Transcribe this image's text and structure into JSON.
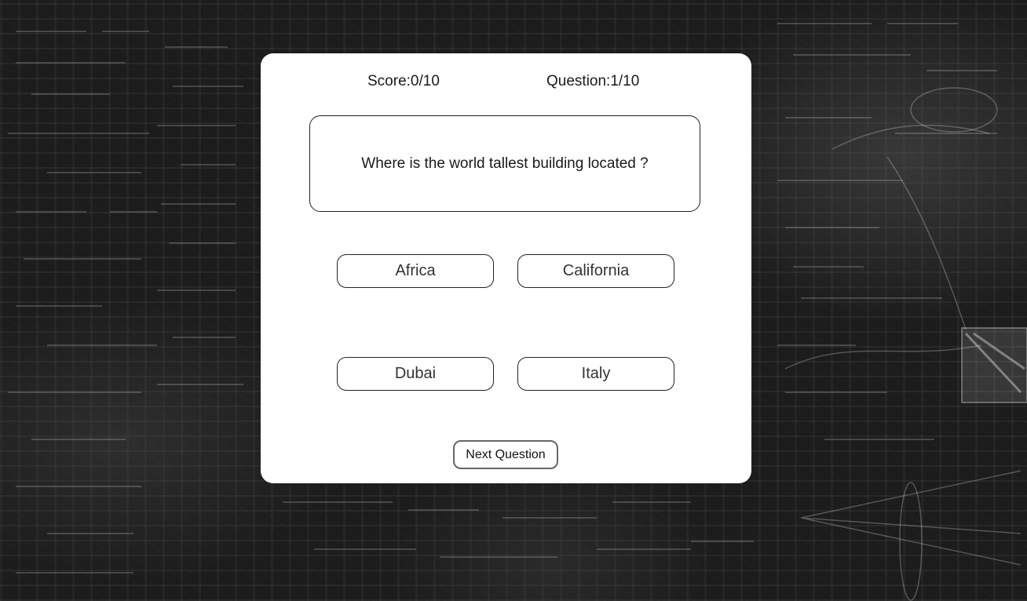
{
  "status": {
    "score": "Score:0/10",
    "question_counter": "Question:1/10"
  },
  "question": {
    "text": "Where is the world tallest building located ?"
  },
  "answers": [
    {
      "label": "Africa"
    },
    {
      "label": "California"
    },
    {
      "label": "Dubai"
    },
    {
      "label": "Italy"
    }
  ],
  "controls": {
    "next_label": "Next Question"
  },
  "colors": {
    "background": "#1c1c1c",
    "card": "#ffffff",
    "border": "#222222"
  }
}
